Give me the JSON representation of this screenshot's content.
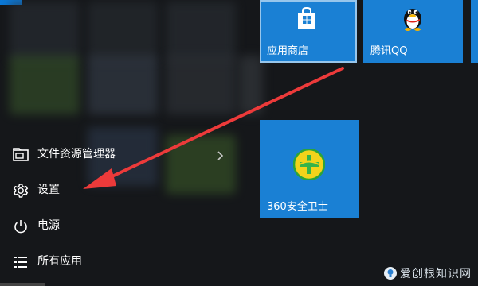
{
  "colors": {
    "tile_blue": "#1a80d4",
    "menu_bg": "#15171a",
    "arrow_red": "#ec3a3a",
    "text": "#ffffff"
  },
  "start_menu": {
    "items": [
      {
        "icon": "file-explorer-icon",
        "label": "文件资源管理器",
        "has_submenu": true
      },
      {
        "icon": "gear-icon",
        "label": "设置",
        "has_submenu": false
      },
      {
        "icon": "power-icon",
        "label": "电源",
        "has_submenu": false
      },
      {
        "icon": "all-apps-list-icon",
        "label": "所有应用",
        "has_submenu": false
      }
    ]
  },
  "tiles": [
    {
      "icon": "store-bag-icon",
      "label": "应用商店"
    },
    {
      "icon": "qq-penguin-icon",
      "label": "腾讯QQ"
    },
    {
      "icon": "360-shield-icon",
      "label": "360安全卫士"
    }
  ],
  "watermark": {
    "text": "爱创根知识网",
    "icon": "lightbulb-icon"
  },
  "annotation": {
    "type": "red-arrow",
    "points_to": "设置"
  }
}
